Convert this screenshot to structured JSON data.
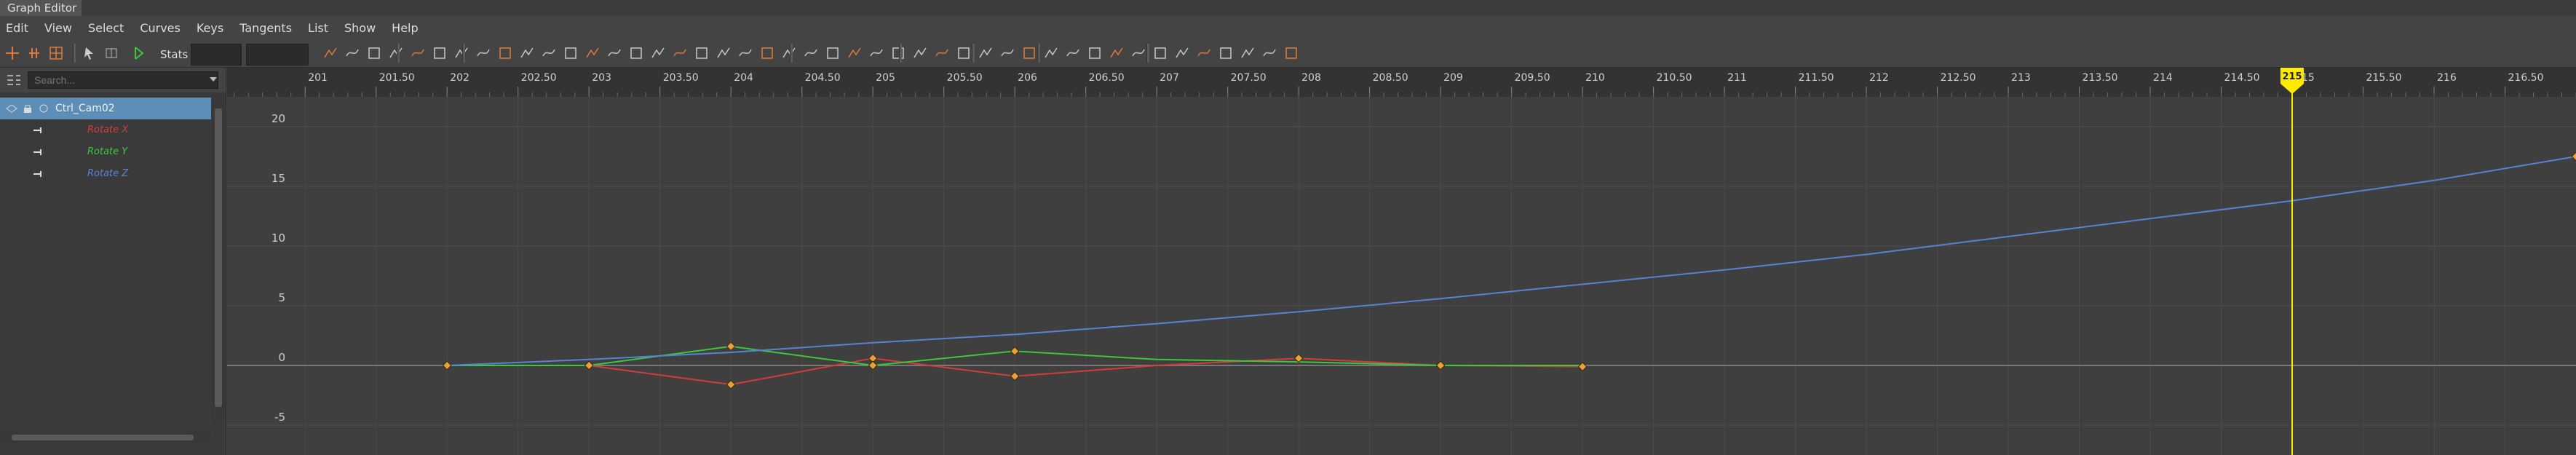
{
  "window": {
    "title": "Graph Editor"
  },
  "menu": [
    "Edit",
    "View",
    "Select",
    "Curves",
    "Keys",
    "Tangents",
    "List",
    "Show",
    "Help"
  ],
  "toolbar": {
    "stats_label": "Stats"
  },
  "outliner": {
    "search_placeholder": "Search...",
    "object": "Ctrl_Cam02",
    "attributes": [
      {
        "label": "Rotate X",
        "color": "#d23c3c"
      },
      {
        "label": "Rotate Y",
        "color": "#3cc83c"
      },
      {
        "label": "Rotate Z",
        "color": "#5a82d2"
      }
    ]
  },
  "graph": {
    "time_ticks": [
      "201",
      "201.50",
      "202",
      "202.50",
      "203",
      "203.50",
      "204",
      "204.50",
      "205",
      "205.50",
      "206",
      "206.50",
      "207",
      "207.50",
      "208",
      "208.50",
      "209",
      "209.50",
      "210",
      "210.50",
      "211",
      "211.50",
      "212",
      "212.50",
      "213",
      "213.50",
      "214",
      "214.50",
      "215",
      "215.50",
      "216",
      "216.50"
    ],
    "value_ticks": [
      "20",
      "15",
      "10",
      "5",
      "0",
      "-5"
    ],
    "current_frame": "215",
    "current_frame_value": 215,
    "colors": {
      "curve_x": "#d23c3c",
      "curve_y": "#3cc83c",
      "curve_z": "#5a82d2",
      "key": "#e8a23a",
      "time_marker": "#ffea00",
      "selected_row": "#5c8eb7"
    }
  },
  "chart_data": {
    "type": "line",
    "xlim": [
      200.45,
      217.0
    ],
    "ylim": [
      -7.5,
      22.5
    ],
    "series": [
      {
        "name": "Rotate X",
        "points": [
          [
            202,
            0
          ],
          [
            203,
            0
          ],
          [
            204,
            -1.6
          ],
          [
            205,
            0.6
          ],
          [
            206,
            -0.9
          ],
          [
            207,
            0.0
          ],
          [
            208,
            0.6
          ],
          [
            209,
            0.0
          ],
          [
            210,
            -0.1
          ]
        ]
      },
      {
        "name": "Rotate Y",
        "points": [
          [
            202,
            0
          ],
          [
            203,
            0
          ],
          [
            204,
            1.6
          ],
          [
            205,
            0.0
          ],
          [
            206,
            1.2
          ],
          [
            207,
            0.5
          ],
          [
            208,
            0.3
          ],
          [
            209,
            0.0
          ],
          [
            210,
            0.0
          ]
        ]
      },
      {
        "name": "Rotate Z",
        "points": [
          [
            202,
            0
          ],
          [
            203,
            0.5
          ],
          [
            204,
            1.1
          ],
          [
            205,
            1.9
          ],
          [
            206,
            2.6
          ],
          [
            207,
            3.5
          ],
          [
            208,
            4.5
          ],
          [
            209,
            5.6
          ],
          [
            210,
            6.8
          ],
          [
            211,
            8.0
          ],
          [
            212,
            9.3
          ],
          [
            213,
            10.8
          ],
          [
            214,
            12.3
          ],
          [
            215,
            13.8
          ],
          [
            216,
            15.5
          ],
          [
            217,
            17.5
          ]
        ]
      }
    ],
    "keys": [
      {
        "series": "Rotate X",
        "x": 202,
        "y": 0
      },
      {
        "series": "Rotate X",
        "x": 203,
        "y": 0
      },
      {
        "series": "Rotate X",
        "x": 204,
        "y": -1.6
      },
      {
        "series": "Rotate X",
        "x": 205,
        "y": 0.6
      },
      {
        "series": "Rotate X",
        "x": 206,
        "y": -0.9
      },
      {
        "series": "Rotate X",
        "x": 208,
        "y": 0.6
      },
      {
        "series": "Rotate X",
        "x": 209,
        "y": 0.0
      },
      {
        "series": "Rotate X",
        "x": 210,
        "y": -0.1
      },
      {
        "series": "Rotate Y",
        "x": 204,
        "y": 1.6
      },
      {
        "series": "Rotate Y",
        "x": 205,
        "y": 0.0
      },
      {
        "series": "Rotate Y",
        "x": 206,
        "y": 1.2
      },
      {
        "series": "Rotate Z",
        "x": 217,
        "y": 17.5
      }
    ]
  }
}
